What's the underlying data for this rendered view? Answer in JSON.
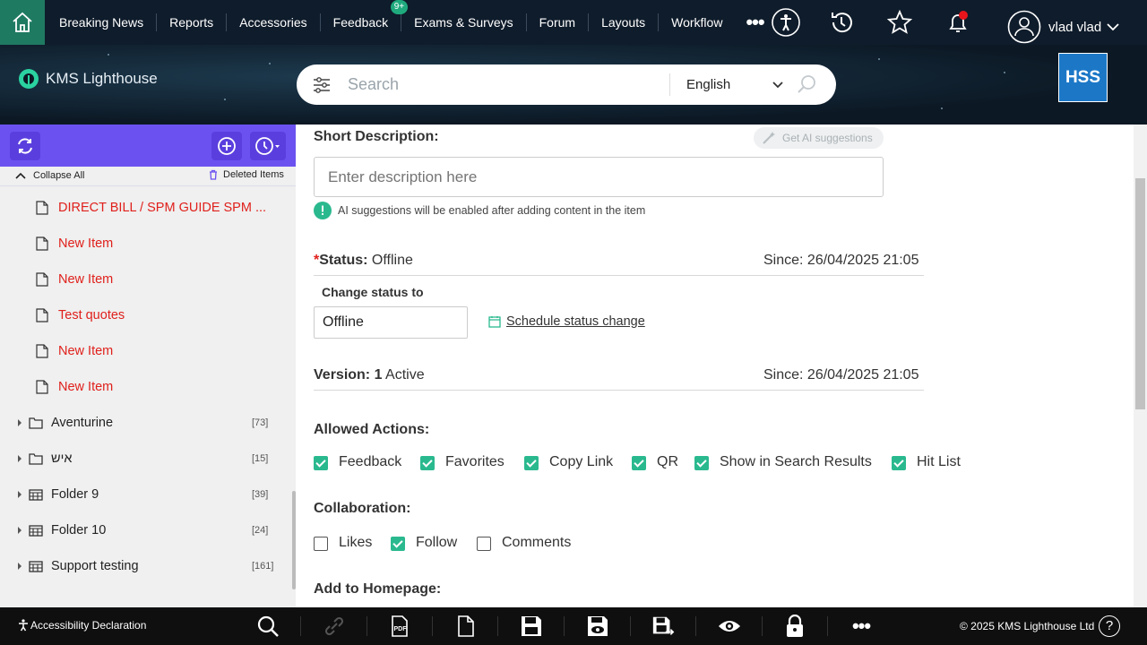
{
  "nav": {
    "items": [
      "Breaking News",
      "Reports",
      "Accessories",
      "Feedback",
      "Exams & Surveys",
      "Forum",
      "Layouts",
      "Workflow"
    ],
    "feedback_badge": "9+",
    "more": "•••",
    "user_name": "vlad vlad"
  },
  "header": {
    "logo_text": "KMS Lighthouse",
    "search_placeholder": "Search",
    "language": "English",
    "badge": "HSS"
  },
  "sidebar": {
    "collapse_all": "Collapse All",
    "deleted_items": "Deleted Items",
    "items": [
      {
        "label": "DIRECT BILL / SPM GUIDE SPM ...",
        "kind": "doc"
      },
      {
        "label": "New Item",
        "kind": "doc"
      },
      {
        "label": "New Item",
        "kind": "doc"
      },
      {
        "label": "Test quotes",
        "kind": "doc"
      },
      {
        "label": "New Item",
        "kind": "doc"
      },
      {
        "label": "New Item",
        "kind": "doc"
      }
    ],
    "folders": [
      {
        "label": "Aventurine",
        "count": "[73]"
      },
      {
        "label": "איש",
        "count": "[15]"
      },
      {
        "label": "Folder 9",
        "count": "[39]"
      },
      {
        "label": "Folder 10",
        "count": "[24]"
      },
      {
        "label": "Support testing",
        "count": "[161]"
      }
    ]
  },
  "main": {
    "short_desc_label": "Short Description:",
    "ai_btn": "Get AI suggestions",
    "desc_placeholder": "Enter description here",
    "ai_note": "AI suggestions will be enabled after adding content in the item",
    "status_star": "*",
    "status_label": "Status:",
    "status_value": "Offline",
    "status_since": "Since: 26/04/2025 21:05",
    "change_status_label": "Change status to",
    "change_status_value": "Offline",
    "schedule_link": "Schedule status change",
    "version_label": "Version: 1",
    "version_value": "Active",
    "version_since": "Since: 26/04/2025 21:05",
    "allowed_label": "Allowed Actions:",
    "allowed": [
      {
        "label": "Feedback",
        "checked": true
      },
      {
        "label": "Favorites",
        "checked": true
      },
      {
        "label": "Copy Link",
        "checked": true
      },
      {
        "label": "QR",
        "checked": true
      },
      {
        "label": "Show in Search Results",
        "checked": true
      },
      {
        "label": "Hit List",
        "checked": true
      }
    ],
    "collab_label": "Collaboration:",
    "collab": [
      {
        "label": "Likes",
        "checked": false
      },
      {
        "label": "Follow",
        "checked": true
      },
      {
        "label": "Comments",
        "checked": false
      }
    ],
    "homepage_label": "Add to Homepage:"
  },
  "footer": {
    "accessibility": "Accessibility Declaration",
    "copyright": "© 2025 KMS Lighthouse Ltd",
    "help": "?"
  },
  "colors": {
    "accent": "#2ab98f",
    "sidebar_toolbar": "#6b52f0",
    "red_item": "#e0201c"
  }
}
